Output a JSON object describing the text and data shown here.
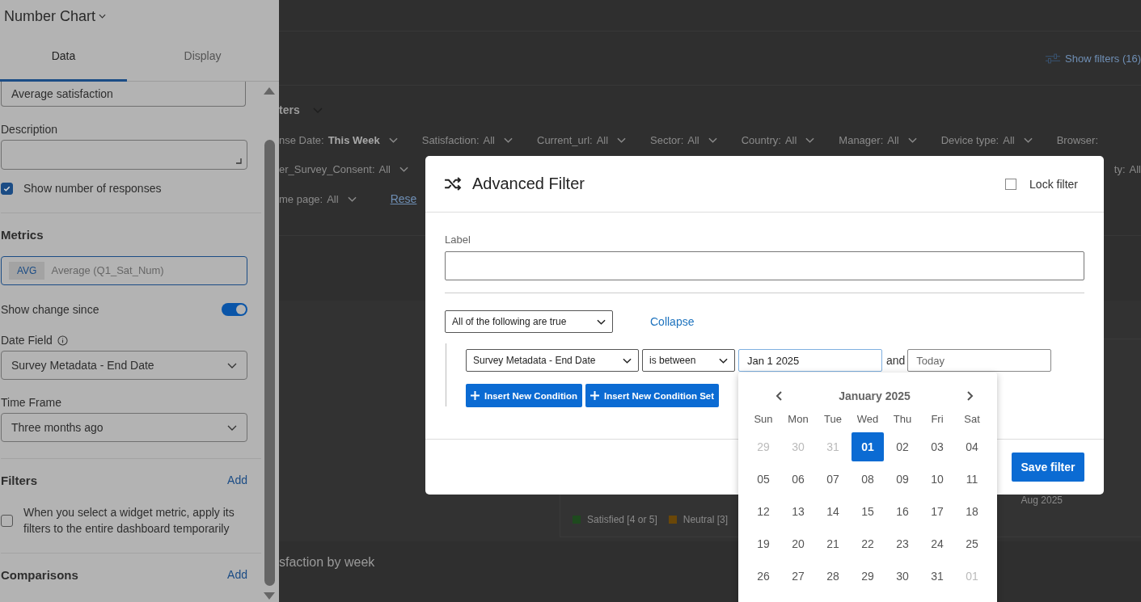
{
  "panel": {
    "title": "Number Chart",
    "tabs": [
      {
        "label": "Data",
        "selected": true
      },
      {
        "label": "Display",
        "selected": false
      }
    ],
    "name_value": "Average satisfaction",
    "description_label": "Description",
    "show_responses": {
      "label": "Show number of responses",
      "checked": true
    },
    "metrics_heading": "Metrics",
    "metric": {
      "tag": "AVG",
      "label": "Average (Q1_Sat_Num)"
    },
    "show_change": {
      "label": "Show change since",
      "on": true
    },
    "date_field": {
      "label": "Date Field",
      "value": "Survey Metadata - End Date"
    },
    "time_frame": {
      "label": "Time Frame",
      "value": "Three months ago"
    },
    "filters": {
      "heading": "Filters",
      "action": "Add",
      "checkbox": {
        "label": "When you select a widget metric, apply its filters to the entire dashboard temporarily",
        "checked": false
      }
    },
    "comparisons": {
      "heading": "Comparisons",
      "action": "Add"
    }
  },
  "dashboard": {
    "show_filters": "Show filters (16)",
    "filters_heading": "ters",
    "filter_rows": [
      {
        "left": [
          {
            "name": "nse Date:",
            "value": "This Week",
            "bold": true
          },
          {
            "name": "Satisfaction:",
            "value": "All",
            "bold": false
          },
          {
            "name": "Current_url:",
            "value": "All",
            "bold": false
          },
          {
            "name": "Sector:",
            "value": "All",
            "bold": false
          },
          {
            "name": "Country:",
            "value": "All",
            "bold": false
          },
          {
            "name": "Manager:",
            "value": "All",
            "bold": false
          },
          {
            "name": "Device type:",
            "value": "All",
            "bold": false
          },
          {
            "name": "Browser:",
            "bold": false
          }
        ],
        "right": []
      },
      {
        "left": [
          {
            "name": "er_Survey_Consent:",
            "value": "All",
            "bold": false
          }
        ],
        "right": [
          {
            "name": "ty:",
            "value": "All",
            "bold": false
          }
        ]
      },
      {
        "left": [
          {
            "name": "me page:",
            "value": "All",
            "bold": false
          }
        ],
        "right": [],
        "link": "Rese"
      }
    ],
    "legend": [
      {
        "label": "Satisfied [4 or 5]",
        "color": "#1e4a1e"
      },
      {
        "label": "Neutral [3]",
        "color": "#6a4708"
      }
    ],
    "axis_label": "Aug 2025",
    "section_title": "sfaction by week"
  },
  "modal": {
    "title": "Advanced Filter",
    "lock": {
      "label": "Lock filter",
      "checked": false
    },
    "label_caption": "Label",
    "conjunction": "All of the following are true",
    "collapse": "Collapse",
    "condition": {
      "field": "Survey Metadata - End Date",
      "operator": "is between",
      "from": "Jan 1 2025",
      "joiner": "and",
      "to_placeholder": "Today"
    },
    "buttons": [
      "Insert New Condition",
      "Insert New Condition Set"
    ],
    "save": "Save filter"
  },
  "calendar": {
    "title": "January 2025",
    "weekdays": [
      "Sun",
      "Mon",
      "Tue",
      "Wed",
      "Thu",
      "Fri",
      "Sat"
    ],
    "weeks": [
      [
        {
          "day": "29",
          "muted": true,
          "selected": false
        },
        {
          "day": "30",
          "muted": true,
          "selected": false
        },
        {
          "day": "31",
          "muted": true,
          "selected": false
        },
        {
          "day": "01",
          "muted": false,
          "selected": true
        },
        {
          "day": "02",
          "muted": false,
          "selected": false
        },
        {
          "day": "03",
          "muted": false,
          "selected": false
        },
        {
          "day": "04",
          "muted": false,
          "selected": false
        }
      ],
      [
        {
          "day": "05",
          "muted": false,
          "selected": false
        },
        {
          "day": "06",
          "muted": false,
          "selected": false
        },
        {
          "day": "07",
          "muted": false,
          "selected": false
        },
        {
          "day": "08",
          "muted": false,
          "selected": false
        },
        {
          "day": "09",
          "muted": false,
          "selected": false
        },
        {
          "day": "10",
          "muted": false,
          "selected": false
        },
        {
          "day": "11",
          "muted": false,
          "selected": false
        }
      ],
      [
        {
          "day": "12",
          "muted": false,
          "selected": false
        },
        {
          "day": "13",
          "muted": false,
          "selected": false
        },
        {
          "day": "14",
          "muted": false,
          "selected": false
        },
        {
          "day": "15",
          "muted": false,
          "selected": false
        },
        {
          "day": "16",
          "muted": false,
          "selected": false
        },
        {
          "day": "17",
          "muted": false,
          "selected": false
        },
        {
          "day": "18",
          "muted": false,
          "selected": false
        }
      ],
      [
        {
          "day": "19",
          "muted": false,
          "selected": false
        },
        {
          "day": "20",
          "muted": false,
          "selected": false
        },
        {
          "day": "21",
          "muted": false,
          "selected": false
        },
        {
          "day": "22",
          "muted": false,
          "selected": false
        },
        {
          "day": "23",
          "muted": false,
          "selected": false
        },
        {
          "day": "24",
          "muted": false,
          "selected": false
        },
        {
          "day": "25",
          "muted": false,
          "selected": false
        }
      ],
      [
        {
          "day": "26",
          "muted": false,
          "selected": false
        },
        {
          "day": "27",
          "muted": false,
          "selected": false
        },
        {
          "day": "28",
          "muted": false,
          "selected": false
        },
        {
          "day": "29",
          "muted": false,
          "selected": false
        },
        {
          "day": "30",
          "muted": false,
          "selected": false
        },
        {
          "day": "31",
          "muted": false,
          "selected": false
        },
        {
          "day": "01",
          "muted": true,
          "selected": false
        }
      ]
    ]
  }
}
